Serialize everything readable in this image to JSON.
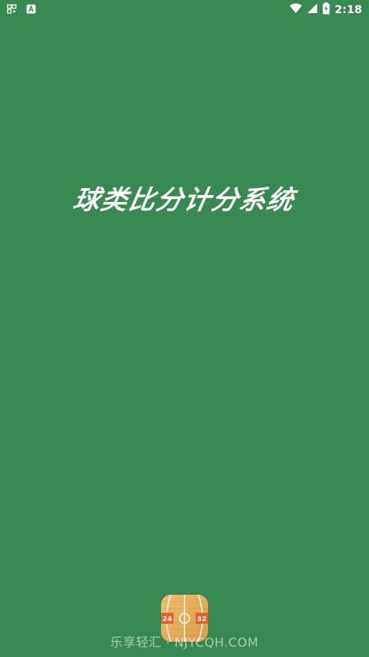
{
  "status_bar": {
    "time": "2:18",
    "icons": [
      "qr-code-icon",
      "keyboard-a-icon",
      "wifi-icon",
      "signal-icon",
      "battery-charging-icon"
    ]
  },
  "splash": {
    "title": "球类比分计分系统"
  },
  "logo": {
    "left_score": "24",
    "right_score": "32"
  },
  "watermark": {
    "text": "乐享轻汇 · NJYCQH.COM"
  },
  "colors": {
    "background": "#378a52",
    "wood": "#e3a95a",
    "score_badge": "#e8602b",
    "text": "#ffffff"
  }
}
